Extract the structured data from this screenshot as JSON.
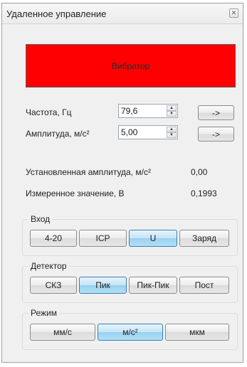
{
  "window": {
    "title": "Удаленное управление",
    "close_glyph": "✕"
  },
  "banner": {
    "label": "Вибратор",
    "color": "#ff0000"
  },
  "frequency": {
    "label": "Частота, Гц",
    "value": "79,6",
    "apply_label": "->"
  },
  "amplitude": {
    "label": "Амплитуда, м/с²",
    "value": "5,00",
    "apply_label": "->"
  },
  "spinner_icons": {
    "up": "▲",
    "down": "▼"
  },
  "readouts": {
    "set_amplitude_label": "Установленная амплитуда, м/с²",
    "set_amplitude_value": "0,00",
    "measured_label": "Измеренное значение, В",
    "measured_value": "0,1993"
  },
  "input_group": {
    "title": "Вход",
    "options": [
      "4-20",
      "ICP",
      "U",
      "Заряд"
    ],
    "selected": "U"
  },
  "detector_group": {
    "title": "Детектор",
    "options": [
      "СКЗ",
      "Пик",
      "Пик-Пик",
      "Пост"
    ],
    "selected": "Пик"
  },
  "mode_group": {
    "title": "Режим",
    "options": [
      "мм/с",
      "м/с²",
      "мкм"
    ],
    "selected": "м/с²"
  },
  "accent_color": "#98d1ef"
}
